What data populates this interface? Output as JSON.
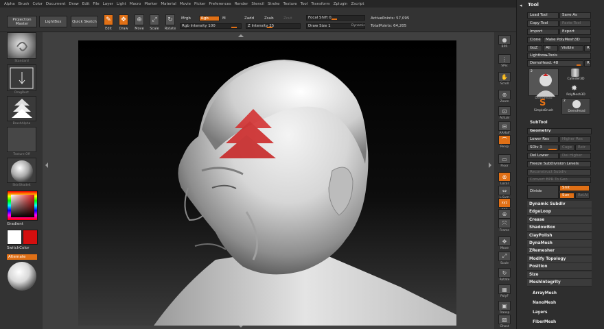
{
  "menubar": [
    "Alpha",
    "Brush",
    "Color",
    "Document",
    "Draw",
    "Edit",
    "File",
    "Layer",
    "Light",
    "Macro",
    "Marker",
    "Material",
    "Movie",
    "Picker",
    "Preferences",
    "Render",
    "Stencil",
    "Stroke",
    "Texture",
    "Tool",
    "Transform",
    "Zplugin",
    "Zscript"
  ],
  "topshelf": {
    "projection_master": "Projection Master",
    "lightbox": "LightBox",
    "quick_sketch": "Quick Sketch",
    "edit": "Edit",
    "draw": "Draw",
    "move": "Move",
    "scale": "Scale",
    "rotate": "Rotate",
    "mrgb": "Mrgb",
    "rgb": "Rgb",
    "m": "M",
    "rgb_intensity": "Rgb Intensity 100",
    "zadd": "Zadd",
    "zsub": "Zsub",
    "zcut": "Zcut",
    "z_intensity": "Z Intensity 25",
    "focal_shift": "Focal Shift 0",
    "draw_size": "Draw Size 1",
    "dynamic": "Dynamic",
    "active_points": "ActivePoints: 57,095",
    "total_points": "TotalPoints: 64,205"
  },
  "leftshelf": {
    "brush_caption": "Standard",
    "stroke_caption": "DragRect",
    "alpha_caption": "BrushAlpha",
    "texture_caption": "Texture Off",
    "material_caption": "SkinShade4",
    "gradient_label": "Gradient",
    "switchcolor_label": "SwitchColor",
    "alternate_label": "Alternate"
  },
  "rightshelf": [
    "BPR",
    "SPix",
    "Scroll",
    "Zoom",
    "Actual",
    "AAHalf",
    "Persp",
    "Floor",
    "Local",
    "L.Sym",
    "XYZ",
    "",
    "Frame",
    "Move",
    "Scale",
    "Rotate",
    "PolyF",
    "Transp",
    "Ghost",
    "Solo"
  ],
  "toolpanel": {
    "title": "Tool",
    "load_tool": "Load Tool",
    "save_as": "Save As",
    "copy_tool": "Copy Tool",
    "paste_tool": "Paste Tool",
    "import": "Import",
    "export": "Export",
    "clone": "Clone",
    "make_polymesh": "Make PolyMesh3D",
    "goz": "GoZ",
    "all": "All",
    "visible": "Visible",
    "r": "R",
    "lightbox_tools": "Lightbox▸Tools",
    "current_tool": "DemoHead. 48",
    "thumbs": [
      {
        "label": "DemoHead",
        "badge": "2"
      },
      {
        "label": "Cylinder3D",
        "badge": ""
      },
      {
        "label": "PolyMesh3D",
        "badge": ""
      },
      {
        "label": "SimpleBrush",
        "badge": ""
      },
      {
        "label": "DemoHead",
        "badge": "2"
      }
    ],
    "subtool": "SubTool",
    "geometry": "Geometry",
    "lower_res": "Lower Res",
    "higher_res": "Higher Res",
    "sdiv": "SDiv 3",
    "cage": "Cage",
    "rstr": "Rstr",
    "del_lower": "Del Lower",
    "del_higher": "Del Higher",
    "freeze_subdivision": "Freeze SubDivision Levels",
    "reconstruct_subdiv": "Reconstruct Subdiv",
    "convert_bpr": "Convert BPR To Geo",
    "divide": "Divide",
    "smt": "Smt",
    "suv": "Suv",
    "reuv": "ReUV",
    "geometry_items": [
      "Dynamic Subdiv",
      "EdgeLoop",
      "Crease",
      "ShadowBox",
      "ClayPolish",
      "DynaMesh",
      "ZRemesher",
      "Modify Topology",
      "Position",
      "Size",
      "MeshIntegrity"
    ],
    "sections": [
      "ArrayMesh",
      "NanoMesh",
      "Layers",
      "FiberMesh"
    ]
  }
}
